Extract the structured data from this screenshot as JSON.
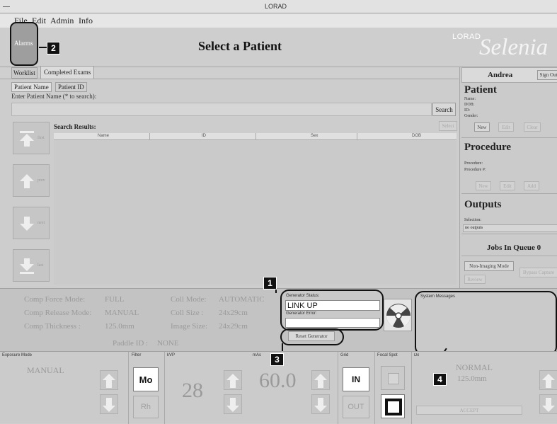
{
  "window": {
    "title": "LORAD"
  },
  "menu": [
    "File",
    "Edit",
    "Admin",
    "Info"
  ],
  "header": {
    "alarms_label": "Alarms",
    "page_title": "Select a Patient",
    "brand_small": "LORAD",
    "brand_large": "Selenia"
  },
  "tabs": [
    "Worklist",
    "Completed Exams"
  ],
  "subtabs": [
    "Patient Name",
    "Patient ID"
  ],
  "search": {
    "prompt": "Enter Patient Name (* to search):",
    "value": "",
    "button": "Search",
    "results_label": "Search Results:",
    "select_button": "Select",
    "columns": [
      "Name",
      "ID",
      "Sex",
      "DOB"
    ]
  },
  "nav_buttons": [
    "first",
    "prev",
    "next",
    "last"
  ],
  "right_panel": {
    "user": "Andrea",
    "sign_out": "Sign Out",
    "patient": {
      "title": "Patient",
      "fields": [
        "Name:",
        "DOB:",
        "ID:",
        "Gender:"
      ],
      "buttons": [
        "New",
        "Edit",
        "Clear"
      ]
    },
    "procedure": {
      "title": "Procedure",
      "fields": [
        "Procedure:",
        "Procedure #:"
      ],
      "buttons": [
        "New",
        "Edit",
        "Add"
      ]
    },
    "outputs": {
      "title": "Outputs",
      "selection_label": "Selection:",
      "selection_value": "no outputs"
    },
    "jobs": "Jobs In Queue 0",
    "non_imaging": "Non-Imaging Mode",
    "bypass_capture": "Bypass Capture",
    "review": "Review"
  },
  "status": {
    "comp_force_mode_label": "Comp Force  Mode:",
    "comp_force_mode_value": "FULL",
    "comp_release_mode_label": "Comp Release Mode:",
    "comp_release_mode_value": "MANUAL",
    "comp_thickness_label": "Comp Thickness  :",
    "comp_thickness_value": "125.0mm",
    "coll_mode_label": "Coll Mode:",
    "coll_mode_value": "AUTOMATIC",
    "coll_size_label": "Coll Size :",
    "coll_size_value": "24x29cm",
    "image_size_label": "Image Size:",
    "image_size_value": "24x29cm",
    "paddle_id_label": "Paddle ID  :",
    "paddle_id_value": "NONE",
    "generator_status_label": "Generator Status:",
    "generator_status_value": "LINK UP",
    "generator_error_label": "Generator Error:",
    "generator_error_value": "",
    "reset_generator": "Reset Generator",
    "system_messages": "System Messages"
  },
  "exposure": {
    "mode_label": "Exposure Mode",
    "mode_value": "MANUAL",
    "filter_label": "Filter",
    "filter_options": [
      "Mo",
      "Rh"
    ],
    "kvp_label": "kVP",
    "kvp_value": "28",
    "mas_label": "mAs",
    "mas_value": "60.0",
    "grid_label": "Grid",
    "grid_options": [
      "IN",
      "OUT"
    ],
    "focal_spot_label": "Focal Spot",
    "density_label": "Density",
    "aec_mode": "NORMAL",
    "aec_thickness": "125.0mm",
    "accept": "ACCEPT"
  },
  "callouts": [
    "1",
    "2",
    "3",
    "4"
  ]
}
